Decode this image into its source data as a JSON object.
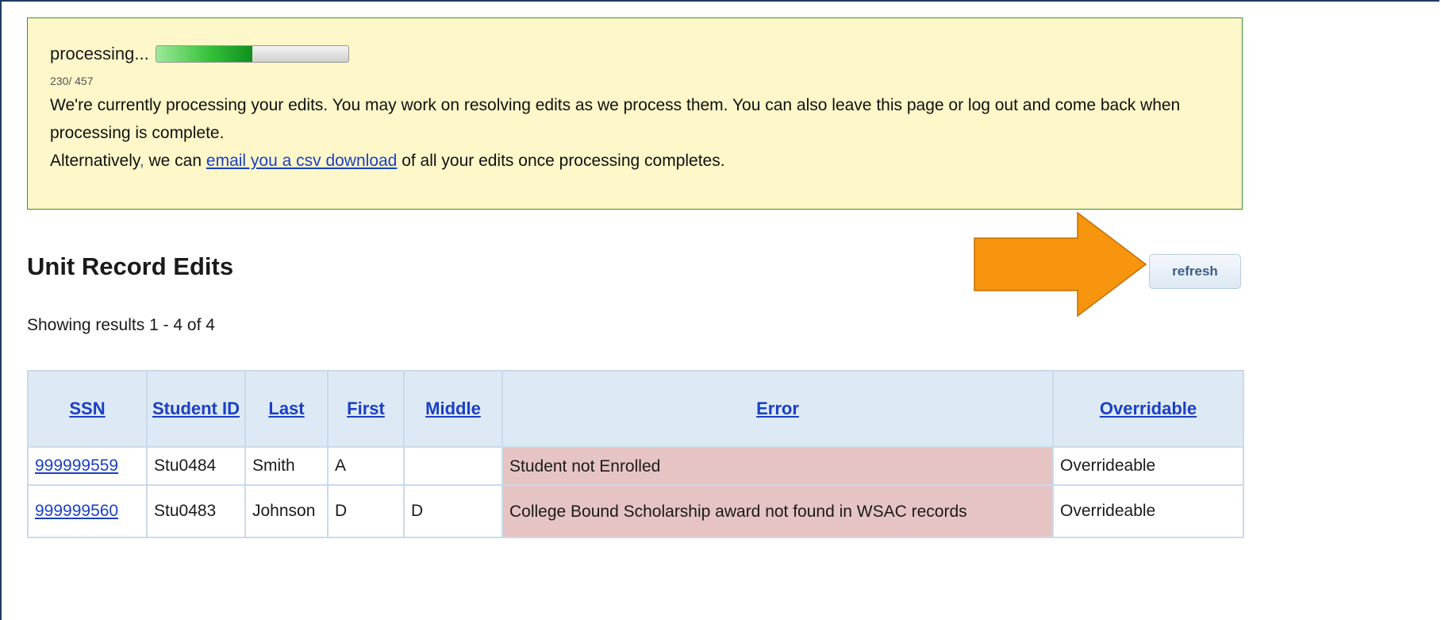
{
  "notice": {
    "processing_label": "processing...",
    "progress_fraction": 0.5,
    "count_text": "230/ 457",
    "message_line1": "We're currently processing your edits. You may work on resolving edits as we process them. You can also leave this page or log out and come back when processing is complete.",
    "alt_prefix": "Alternatively",
    "alt_middle": " we can ",
    "email_link": "email you a csv download",
    "alt_suffix": " of all your edits once processing completes."
  },
  "page_title": "Unit Record Edits",
  "refresh_label": "refresh",
  "showing_text": "Showing results 1 - 4 of 4",
  "colors": {
    "notice_bg": "#fdf7c9",
    "notice_border": "#3f8f2f",
    "link": "#1a3fc4",
    "header_bg": "#dde9f5",
    "error_bg": "#e6c4c4",
    "arrow": "#f7950f"
  },
  "table": {
    "headers": [
      "SSN",
      "Student ID",
      "Last",
      "First",
      "Middle",
      "Error",
      "Overridable"
    ],
    "rows": [
      {
        "ssn": "999999559",
        "student_id": "Stu0484",
        "last": "Smith",
        "first": "A",
        "middle": "",
        "error": "Student not Enrolled",
        "overridable": "Overrideable"
      },
      {
        "ssn": "999999560",
        "student_id": "Stu0483",
        "last": "Johnson",
        "first": "D",
        "middle": "D",
        "error": "College Bound Scholarship award not found in WSAC records",
        "overridable": "Overrideable"
      }
    ]
  }
}
